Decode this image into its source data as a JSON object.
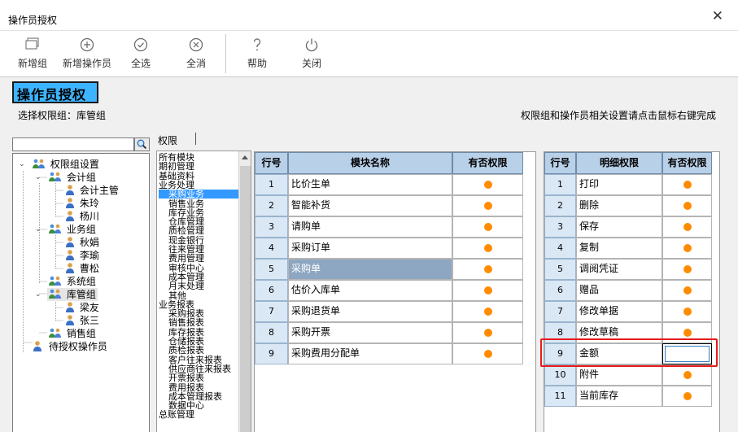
{
  "window": {
    "title": "操作员授权"
  },
  "toolbar": {
    "new_group": "新增组",
    "new_operator": "新增操作员",
    "select_all": "全选",
    "deselect_all": "全消",
    "help": "帮助",
    "close": "关闭"
  },
  "header": {
    "title": "操作员授权",
    "current_group": "选择权限组：库管组",
    "hint": "权限组和操作员相关设置请点击鼠标右键完成"
  },
  "tree": {
    "root": "权限组设置",
    "groups": [
      {
        "name": "会计组",
        "members": [
          "会计主管",
          "朱玲",
          "杨川"
        ]
      },
      {
        "name": "业务组",
        "members": [
          "秋娟",
          "李瑜",
          "曹松"
        ]
      },
      {
        "name": "系统组",
        "members": []
      },
      {
        "name": "库管组",
        "members": [
          "梁友",
          "张三"
        ]
      },
      {
        "name": "销售组",
        "members": []
      }
    ],
    "pending": "待授权操作员"
  },
  "tab": {
    "label": "权限"
  },
  "modules": [
    "所有模块",
    "期初管理",
    "基础资料",
    "业务处理",
    "采购业务",
    "销售业务",
    "库存业务",
    "仓库管理",
    "质检管理",
    "现金银行",
    "往来管理",
    "费用管理",
    "审核中心",
    "成本管理",
    "月末处理",
    "其他",
    "业务报表",
    "采购报表",
    "销售报表",
    "库存报表",
    "仓储报表",
    "质检报表",
    "客户往来报表",
    "供应商往来报表",
    "开票报表",
    "费用报表",
    "成本管理报表",
    "数据中心",
    "总账管理"
  ],
  "module_table": {
    "headers": [
      "行号",
      "模块名称",
      "有否权限"
    ],
    "rows": [
      {
        "no": "1",
        "name": "比价生单"
      },
      {
        "no": "2",
        "name": "智能补货"
      },
      {
        "no": "3",
        "name": "请购单"
      },
      {
        "no": "4",
        "name": "采购订单"
      },
      {
        "no": "5",
        "name": "采购单"
      },
      {
        "no": "6",
        "name": "估价入库单"
      },
      {
        "no": "7",
        "name": "采购退货单"
      },
      {
        "no": "8",
        "name": "采购开票"
      },
      {
        "no": "9",
        "name": "采购费用分配单"
      }
    ],
    "selected_row": 5
  },
  "detail_table": {
    "headers": [
      "行号",
      "明细权限",
      "有否权限"
    ],
    "rows": [
      {
        "no": "1",
        "name": "打印"
      },
      {
        "no": "2",
        "name": "删除"
      },
      {
        "no": "3",
        "name": "保存"
      },
      {
        "no": "4",
        "name": "复制"
      },
      {
        "no": "5",
        "name": "调阅凭证"
      },
      {
        "no": "6",
        "name": "赠品"
      },
      {
        "no": "7",
        "name": "修改单据"
      },
      {
        "no": "8",
        "name": "修改草稿"
      },
      {
        "no": "9",
        "name": "金额"
      },
      {
        "no": "10",
        "name": "附件"
      },
      {
        "no": "11",
        "name": "当前库存"
      }
    ],
    "editing_row": 9
  },
  "colors": {
    "accent": "#3db4ff",
    "dot": "#ff8c00",
    "header_bg": "#b8d0e8",
    "selected_row": "#8da7c2",
    "highlight": "#e81a1a"
  },
  "icons": [
    "window-stack-icon",
    "plus-circle-icon",
    "check-circle-icon",
    "x-circle-icon",
    "question-icon",
    "power-icon",
    "search-icon",
    "group-icon",
    "user-icon"
  ]
}
